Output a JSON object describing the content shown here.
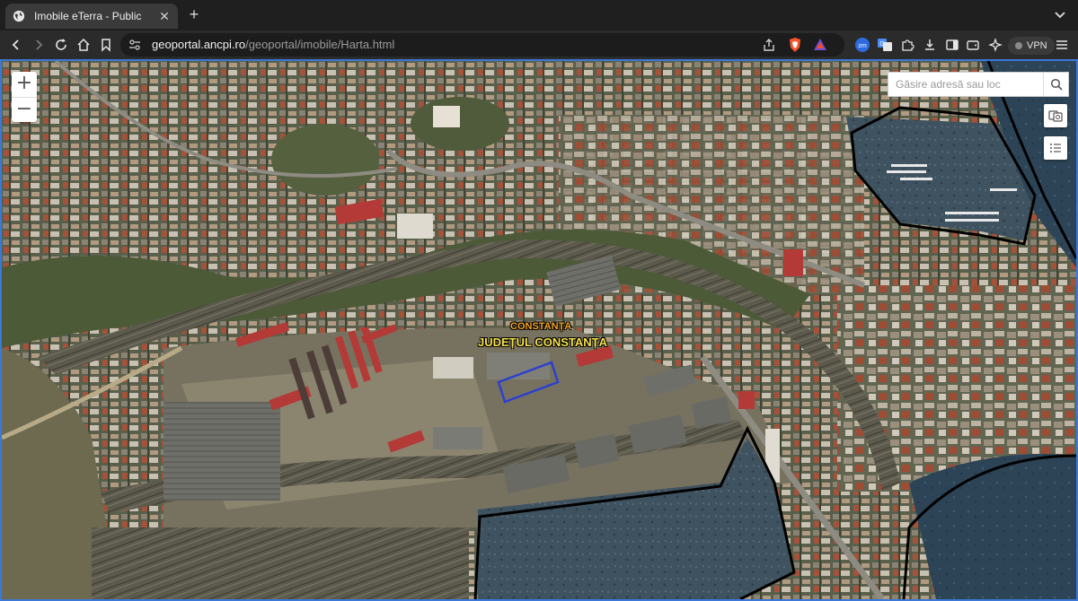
{
  "browser": {
    "tab_title": "Imobile eTerra - Public",
    "url_host": "geoportal.ancpi.ro",
    "url_path": "/geoportal/imobile/Harta.html",
    "vpn_label": "VPN"
  },
  "map": {
    "search_placeholder": "Găsire adresă sau loc",
    "labels": {
      "city": "CONSTANȚA",
      "county": "JUDEȚUL CONSTANȚA"
    },
    "highlight_color": "#2c3fd0",
    "boundary_color": "#000000"
  },
  "icons": {
    "zoom_in": "plus-icon",
    "zoom_out": "minus-icon",
    "search": "magnifier-icon",
    "basemap": "basemap-gallery-icon",
    "layers": "layer-list-icon"
  }
}
